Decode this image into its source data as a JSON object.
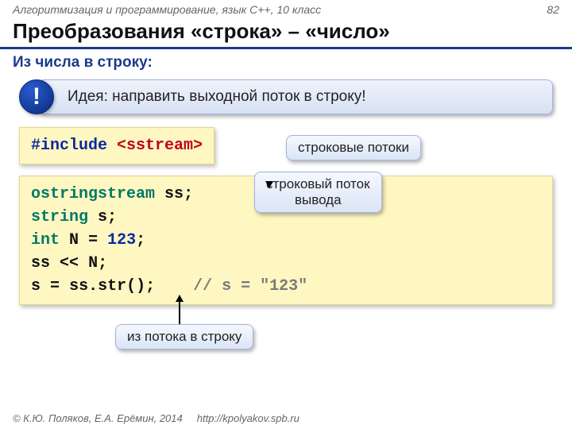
{
  "header": {
    "course": "Алгоритмизация и программирование, язык C++, 10 класс",
    "page_num": "82",
    "title": "Преобразования «строка» – «число»",
    "subtitle": "Из числа в строку:"
  },
  "idea": {
    "badge": "!",
    "text": "Идея: направить выходной поток в строку!"
  },
  "code1": {
    "include_kw": "#include",
    "include_hdr": "<sstream>"
  },
  "code2": {
    "l1_type": "ostringstream",
    "l1_var": "ss",
    "l1_semi": ";",
    "l2_type": "string",
    "l2_var": "s",
    "l2_semi": ";",
    "l3_type": "int",
    "l3_var": "N",
    "l3_eq": "=",
    "l3_val": "123",
    "l3_semi": ";",
    "l4_var": "ss",
    "l4_op": "<<",
    "l4_rhs": "N",
    "l4_semi": ";",
    "l5_lhs": "s",
    "l5_eq": "=",
    "l5_rhs": "ss.str()",
    "l5_semi": ";",
    "l5_comment": "// s = \"123\""
  },
  "callouts": {
    "c1": "строковые потоки",
    "c2_line1": "строковый поток",
    "c2_line2": "вывода",
    "c3": "из потока в строку"
  },
  "footer": {
    "copyright": "© К.Ю. Поляков, Е.А. Ерёмин, 2014",
    "url": "http://kpolyakov.spb.ru"
  }
}
